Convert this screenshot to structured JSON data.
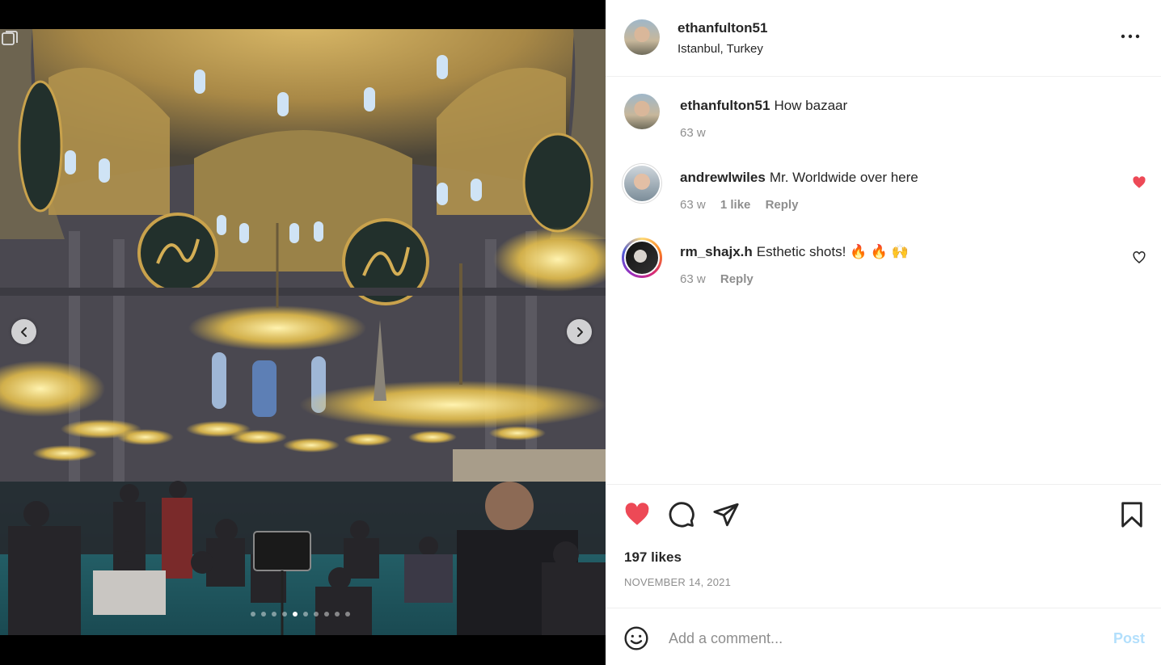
{
  "post": {
    "username": "ethanfulton51",
    "location": "Istanbul, Turkey"
  },
  "comments": [
    {
      "username": "ethanfulton51",
      "text": "How bazaar",
      "time": "63 w"
    },
    {
      "username": "andrewlwiles",
      "text": "Mr. Worldwide over here",
      "time": "63 w",
      "likes": "1 like",
      "reply": "Reply",
      "liked": true
    },
    {
      "username": "rm_shajx.h",
      "text": "Esthetic shots! 🔥 🔥 🙌",
      "time": "63 w",
      "reply": "Reply",
      "liked": false
    }
  ],
  "engagement": {
    "likes": "197 likes",
    "date": "NOVEMBER 14, 2021",
    "liked": true
  },
  "composer": {
    "placeholder": "Add a comment...",
    "post_label": "Post"
  },
  "carousel": {
    "total_slides": 10,
    "active_index": 4
  },
  "colors": {
    "like_red": "#ed4956",
    "post_button_disabled": "#b2dffc",
    "muted_text": "#8e8e8e"
  },
  "icons": [
    "more-options-icon",
    "heart-icon",
    "comment-icon",
    "share-icon",
    "bookmark-icon",
    "emoji-icon",
    "chevron-left-icon",
    "chevron-right-icon"
  ]
}
